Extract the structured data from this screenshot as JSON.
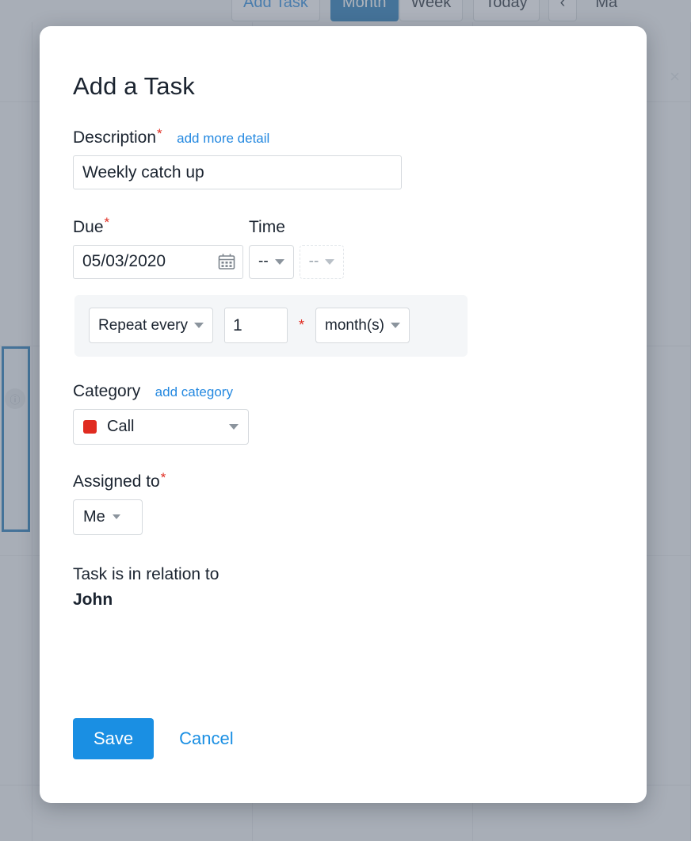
{
  "background": {
    "toolbar": {
      "add_task": "Add Task",
      "month": "Month",
      "week": "Week",
      "today": "Today",
      "prev": "‹",
      "month_label": "Ma"
    },
    "close_icon": "×",
    "cell_icon": "ⓘ"
  },
  "modal": {
    "title": "Add a Task",
    "description": {
      "label": "Description",
      "required_mark": "*",
      "add_more_link": "add more detail",
      "value": "Weekly catch up",
      "placeholder": ""
    },
    "due": {
      "label": "Due",
      "required_mark": "*",
      "value": "05/03/2020",
      "calendar_icon": "calendar-icon"
    },
    "time": {
      "label": "Time",
      "hour_value": "--",
      "minute_value": "--"
    },
    "repeat": {
      "frequency_label": "Repeat every",
      "interval_value": "1",
      "required_mark": "*",
      "unit_label": "month(s)"
    },
    "category": {
      "label": "Category",
      "add_link": "add category",
      "selected": "Call",
      "swatch_color": "#e02b20"
    },
    "assigned": {
      "label": "Assigned to",
      "required_mark": "*",
      "selected": "Me"
    },
    "relation": {
      "line1": "Task is in relation to",
      "line2": "John"
    },
    "footer": {
      "save_label": "Save",
      "cancel_label": "Cancel"
    }
  },
  "colors": {
    "accent": "#1a8fe3",
    "required": "#e02b20",
    "link": "#2388e0",
    "panel": "#f4f6f8"
  }
}
